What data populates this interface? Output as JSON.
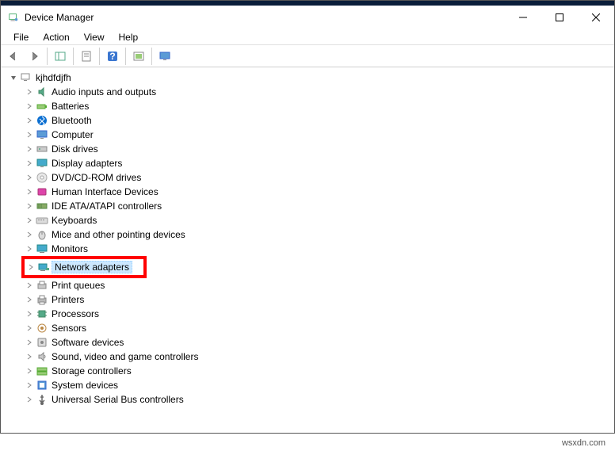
{
  "window": {
    "title": "Device Manager"
  },
  "menu": {
    "file": "File",
    "action": "Action",
    "view": "View",
    "help": "Help"
  },
  "tree": {
    "root": "kjhdfdjfh",
    "items": [
      {
        "label": "Audio inputs and outputs",
        "icon": "audio"
      },
      {
        "label": "Batteries",
        "icon": "battery"
      },
      {
        "label": "Bluetooth",
        "icon": "bluetooth"
      },
      {
        "label": "Computer",
        "icon": "computer"
      },
      {
        "label": "Disk drives",
        "icon": "disk"
      },
      {
        "label": "Display adapters",
        "icon": "display"
      },
      {
        "label": "DVD/CD-ROM drives",
        "icon": "dvd"
      },
      {
        "label": "Human Interface Devices",
        "icon": "hid"
      },
      {
        "label": "IDE ATA/ATAPI controllers",
        "icon": "ide"
      },
      {
        "label": "Keyboards",
        "icon": "keyboard"
      },
      {
        "label": "Mice and other pointing devices",
        "icon": "mouse"
      },
      {
        "label": "Monitors",
        "icon": "monitor"
      },
      {
        "label": "Network adapters",
        "icon": "network",
        "selected": true
      },
      {
        "label": "Print queues",
        "icon": "printq"
      },
      {
        "label": "Printers",
        "icon": "printer"
      },
      {
        "label": "Processors",
        "icon": "cpu"
      },
      {
        "label": "Sensors",
        "icon": "sensor"
      },
      {
        "label": "Software devices",
        "icon": "software"
      },
      {
        "label": "Sound, video and game controllers",
        "icon": "sound"
      },
      {
        "label": "Storage controllers",
        "icon": "storage"
      },
      {
        "label": "System devices",
        "icon": "system"
      },
      {
        "label": "Universal Serial Bus controllers",
        "icon": "usb"
      }
    ]
  },
  "footer": "wsxdn.com"
}
